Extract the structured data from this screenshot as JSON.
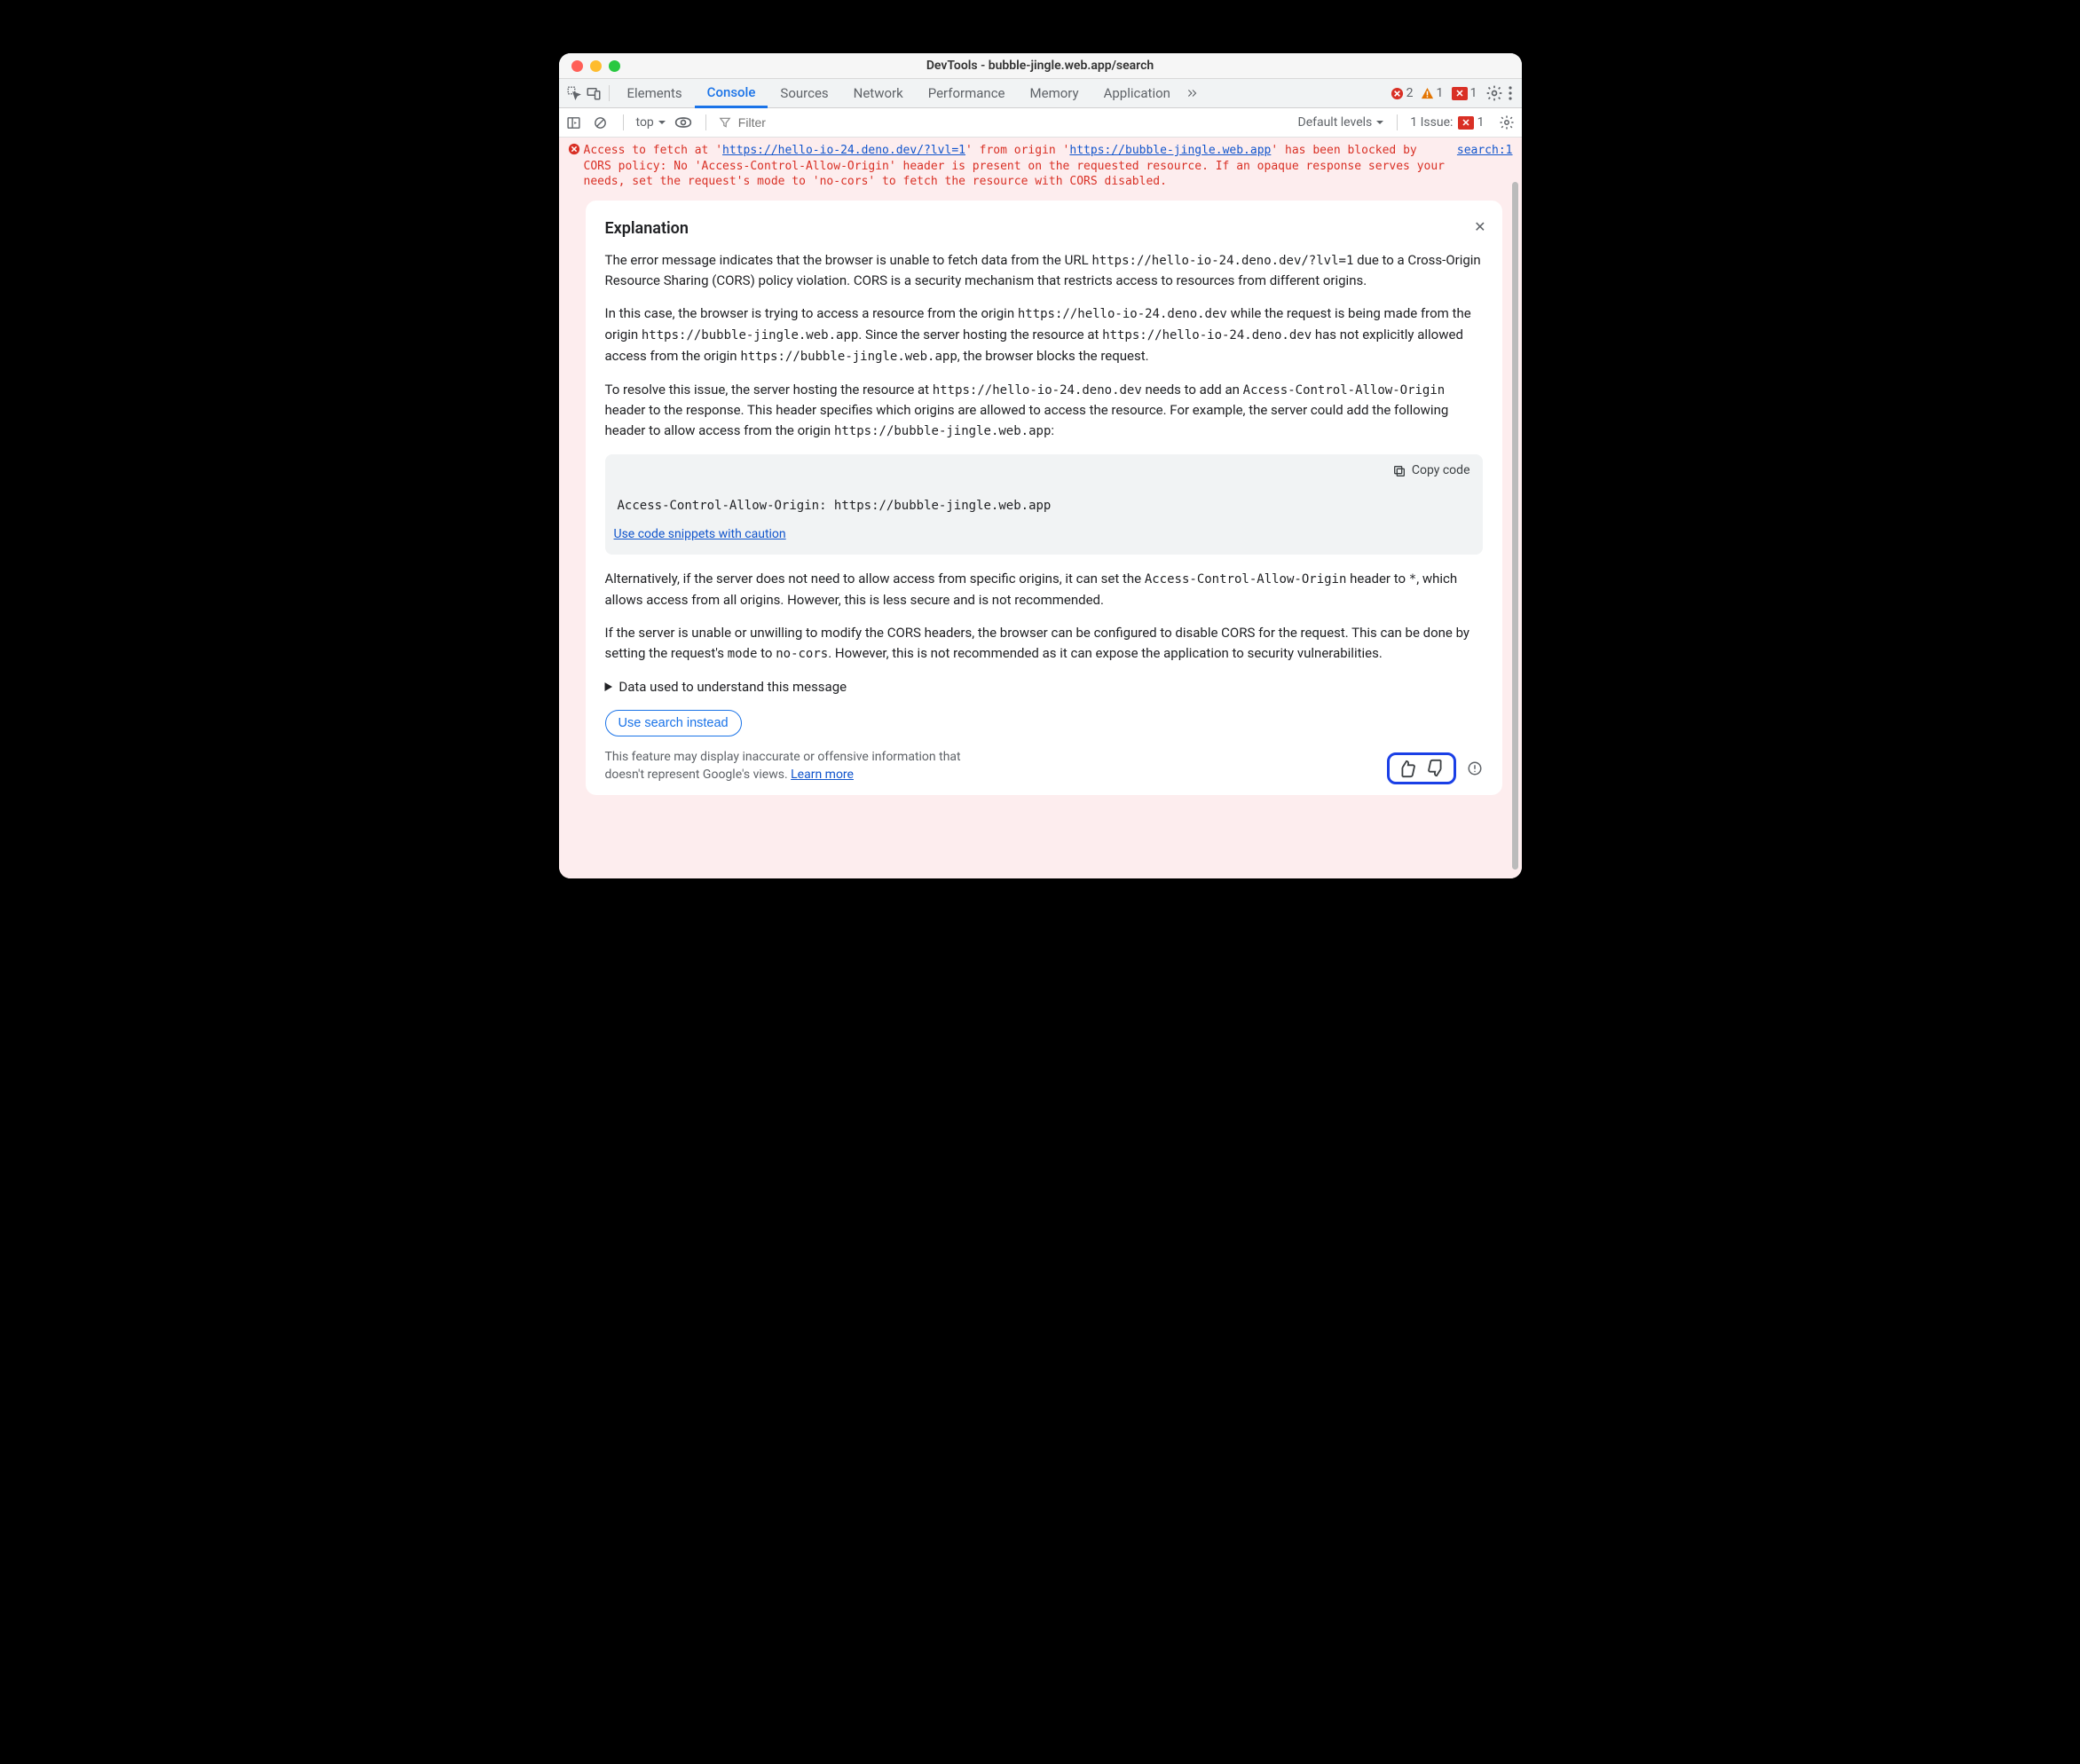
{
  "window": {
    "title": "DevTools - bubble-jingle.web.app/search"
  },
  "tabs": [
    "Elements",
    "Console",
    "Sources",
    "Network",
    "Performance",
    "Memory",
    "Application"
  ],
  "active_tab": "Console",
  "counts": {
    "errors": "2",
    "warnings": "1",
    "issues": "1"
  },
  "subbar": {
    "context": "top",
    "filter_placeholder": "Filter",
    "levels": "Default levels",
    "issue_label": "1 Issue:",
    "issue_badge": "1"
  },
  "error": {
    "pre1": "Access to fetch at '",
    "url1": "https://hello-io-24.deno.dev/?lvl=1",
    "mid1": "' from origin '",
    "url2": "https://bubble-jingle.web.app",
    "post1": "' has been blocked by CORS policy: No 'Access-Control-Allow-Origin' header is present on the requested resource. If an opaque response serves your needs, set the request's mode to 'no-cors' to fetch the resource with CORS disabled.",
    "source": "search:1"
  },
  "expl": {
    "title": "Explanation",
    "p1a": "The error message indicates that the browser is unable to fetch data from the URL ",
    "p1u": "https://hello-io-24.deno.dev/?lvl=1",
    "p1b": " due to a Cross-Origin Resource Sharing (CORS) policy violation. CORS is a security mechanism that restricts access to resources from different origins.",
    "p2a": "In this case, the browser is trying to access a resource from the origin ",
    "p2u1": "https://hello-io-24.deno.dev",
    "p2b": " while the request is being made from the origin ",
    "p2u2": "https://bubble-jingle.web.app",
    "p2c": ". Since the server hosting the resource at ",
    "p2u3": "https://hello-io-24.deno.dev",
    "p2d": " has not explicitly allowed access from the origin ",
    "p2u4": "https://bubble-jingle.web.app",
    "p2e": ", the browser blocks the request.",
    "p3a": "To resolve this issue, the server hosting the resource at ",
    "p3u1": "https://hello-io-24.deno.dev",
    "p3b": " needs to add an ",
    "p3h": "Access-Control-Allow-Origin",
    "p3c": " header to the response. This header specifies which origins are allowed to access the resource. For example, the server could add the following header to allow access from the origin ",
    "p3u2": "https://bubble-jingle.web.app",
    "p3d": ":",
    "copy": "Copy code",
    "code": "Access-Control-Allow-Origin: https://bubble-jingle.web.app",
    "caution": "Use code snippets with caution",
    "p4a": "Alternatively, if the server does not need to allow access from specific origins, it can set the ",
    "p4h": "Access-Control-Allow-Origin",
    "p4b": " header to ",
    "p4s": "*",
    "p4c": ", which allows access from all origins. However, this is less secure and is not recommended.",
    "p5a": "If the server is unable or unwilling to modify the CORS headers, the browser can be configured to disable CORS for the request. This can be done by setting the request's ",
    "p5m": "mode",
    "p5b": " to ",
    "p5n": "no-cors",
    "p5c": ". However, this is not recommended as it can expose the application to security vulnerabilities.",
    "details": "Data used to understand this message",
    "search_btn": "Use search instead",
    "disclaimer1": "This feature may display inaccurate or offensive information that doesn't represent Google's views. ",
    "learn": "Learn more"
  }
}
